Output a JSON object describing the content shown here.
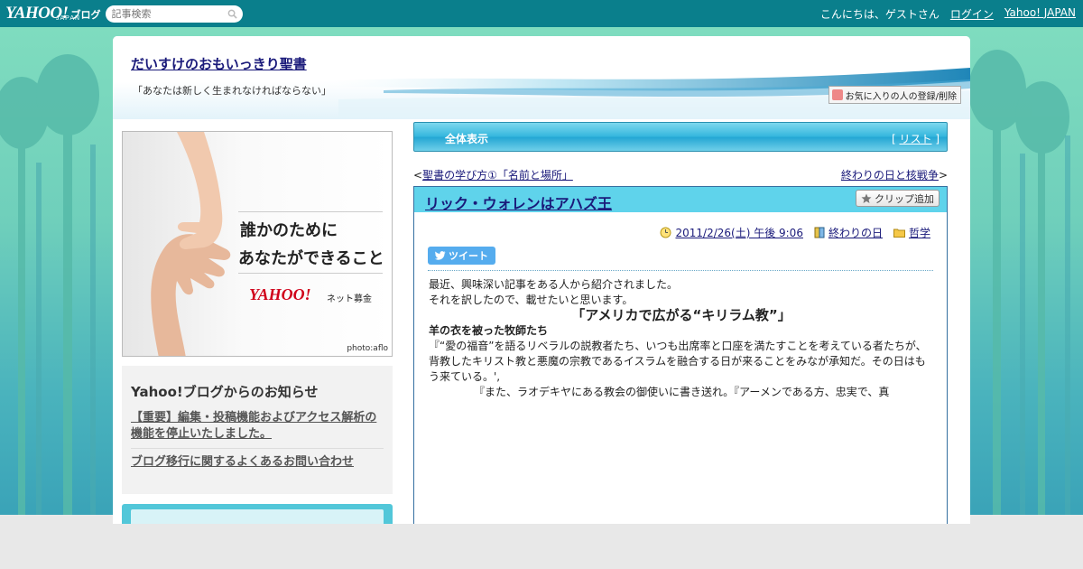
{
  "topbar": {
    "logo": "YAHOO!",
    "logo_sub": "ブログ",
    "logo_jp": "JAPAN",
    "search_placeholder": "記事検索",
    "greeting": "こんにちは、ゲストさん",
    "login": "ログイン",
    "yahoo_japan": "Yahoo! JAPAN"
  },
  "blog": {
    "title": "だいすけのおもいっきり聖書",
    "subtitle": "「あなたは新しく生まれなければならない」",
    "fav_button": "お気に入りの人の登録/削除"
  },
  "ad": {
    "line1": "誰かのために",
    "line2": "あなたができること",
    "logo": "YAHOO!",
    "logo_sub": "ネット募金",
    "credit": "photo:aflo"
  },
  "notice": {
    "heading": "Yahoo!ブログからのお知らせ",
    "links": [
      "【重要】編集・投稿機能およびアクセス解析の機能を停止いたしました。",
      "ブログ移行に関するよくあるお問い合わせ"
    ]
  },
  "tabs": {
    "label": "全体表示",
    "list_open": "[",
    "list": "リスト",
    "list_close": "]"
  },
  "nav": {
    "prev": "聖書の学び方①「名前と場所」",
    "next": "終わりの日と核戦争"
  },
  "article": {
    "title": "リック・ウォレンはアハズ王",
    "clip": "クリップ追加",
    "date": "2011/2/26(土) 午後 9:06",
    "category1": "終わりの日",
    "category2": "哲学",
    "tweet": "ツイート",
    "p1": "最近、興味深い記事をある人から紹介されました。",
    "p2": "それを訳したので、載せたいと思います。",
    "heading": "「アメリカで広がる“キリラム教”」",
    "subheading": "羊の衣を被った牧師たち",
    "p3": "『“愛の福音”を語るリベラルの説教者たち、いつも出席率と口座を満たすことを考えている者たちが、背教したキリスト教と悪魔の宗教であるイスラムを融合する日が来ることをみなが承知だ。その日はもう来ている。',",
    "p4": "『また、ラオデキヤにある教会の御使いに書き送れ。『アーメンである方、忠実で、真"
  },
  "colors": {
    "topbar": "#0a7f8c",
    "tab_blue": "#33b6dd",
    "article_head": "#5fd3eb",
    "link": "#1a1a7a"
  }
}
